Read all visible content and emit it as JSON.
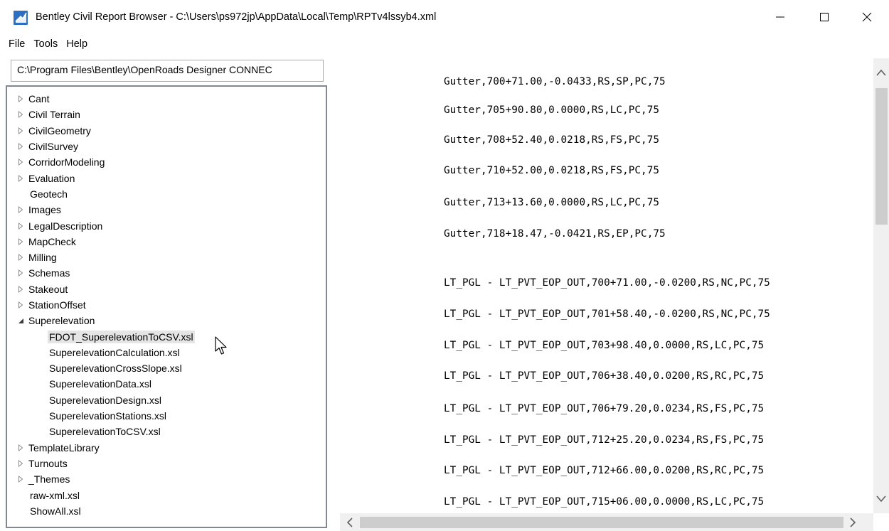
{
  "window": {
    "title": "Bentley Civil Report Browser - C:\\Users\\ps972jp\\AppData\\Local\\Temp\\RPTv4lssyb4.xml",
    "icon": "bentley-report-icon",
    "controls": {
      "minimize": "minimize-icon",
      "maximize": "maximize-icon",
      "close": "close-icon"
    }
  },
  "menu": [
    "File",
    "Tools",
    "Help"
  ],
  "path_field": {
    "value": "C:\\Program Files\\Bentley\\OpenRoads Designer CONNEC"
  },
  "tree": {
    "items": [
      {
        "label": "Cant",
        "arrow": "collapsed"
      },
      {
        "label": "Civil Terrain",
        "arrow": "collapsed"
      },
      {
        "label": "CivilGeometry",
        "arrow": "collapsed"
      },
      {
        "label": "CivilSurvey",
        "arrow": "collapsed"
      },
      {
        "label": "CorridorModeling",
        "arrow": "collapsed"
      },
      {
        "label": "Evaluation",
        "arrow": "collapsed"
      },
      {
        "label": "Geotech",
        "arrow": "none"
      },
      {
        "label": "Images",
        "arrow": "collapsed"
      },
      {
        "label": "LegalDescription",
        "arrow": "collapsed"
      },
      {
        "label": "MapCheck",
        "arrow": "collapsed"
      },
      {
        "label": "Milling",
        "arrow": "collapsed"
      },
      {
        "label": "Schemas",
        "arrow": "collapsed"
      },
      {
        "label": "Stakeout",
        "arrow": "collapsed"
      },
      {
        "label": "StationOffset",
        "arrow": "collapsed"
      },
      {
        "label": "Superelevation",
        "arrow": "expanded"
      },
      {
        "label": "FDOT_SuperelevationToCSV.xsl",
        "arrow": "child",
        "selected": true
      },
      {
        "label": "SuperelevationCalculation.xsl",
        "arrow": "child"
      },
      {
        "label": "SuperelevationCrossSlope.xsl",
        "arrow": "child"
      },
      {
        "label": "SuperelevationData.xsl",
        "arrow": "child"
      },
      {
        "label": "SuperelevationDesign.xsl",
        "arrow": "child"
      },
      {
        "label": "SuperelevationStations.xsl",
        "arrow": "child"
      },
      {
        "label": "SuperelevationToCSV.xsl",
        "arrow": "child"
      },
      {
        "label": "TemplateLibrary",
        "arrow": "collapsed"
      },
      {
        "label": "Turnouts",
        "arrow": "collapsed"
      },
      {
        "label": "_Themes",
        "arrow": "collapsed"
      },
      {
        "label": "raw-xml.xsl",
        "arrow": "none"
      },
      {
        "label": "ShowAll.xsl",
        "arrow": "none"
      }
    ]
  },
  "report": {
    "lines": [
      "Gutter,700+71.00,-0.0433,RS,SP,PC,75",
      "Gutter,705+90.80,0.0000,RS,LC,PC,75",
      "Gutter,708+52.40,0.0218,RS,FS,PC,75",
      "Gutter,710+52.00,0.0218,RS,FS,PC,75",
      "Gutter,713+13.60,0.0000,RS,LC,PC,75",
      "Gutter,718+18.47,-0.0421,RS,EP,PC,75",
      "LT_PGL - LT_PVT_EOP_OUT,700+71.00,-0.0200,RS,NC,PC,75",
      "LT_PGL - LT_PVT_EOP_OUT,701+58.40,-0.0200,RS,NC,PC,75",
      "LT_PGL - LT_PVT_EOP_OUT,703+98.40,0.0000,RS,LC,PC,75",
      "LT_PGL - LT_PVT_EOP_OUT,706+38.40,0.0200,RS,RC,PC,75",
      "LT_PGL - LT_PVT_EOP_OUT,706+79.20,0.0234,RS,FS,PC,75",
      "LT_PGL - LT_PVT_EOP_OUT,712+25.20,0.0234,RS,FS,PC,75",
      "LT_PGL - LT_PVT_EOP_OUT,712+66.00,0.0200,RS,RC,PC,75",
      "LT_PGL - LT_PVT_EOP_OUT,715+06.00,0.0000,RS,LC,PC,75"
    ]
  },
  "scrollbars": {
    "vertical": {
      "up": "chevron-up-icon",
      "down": "chevron-down-icon"
    },
    "horizontal": {
      "left": "chevron-left-icon",
      "right": "chevron-right-icon"
    }
  }
}
